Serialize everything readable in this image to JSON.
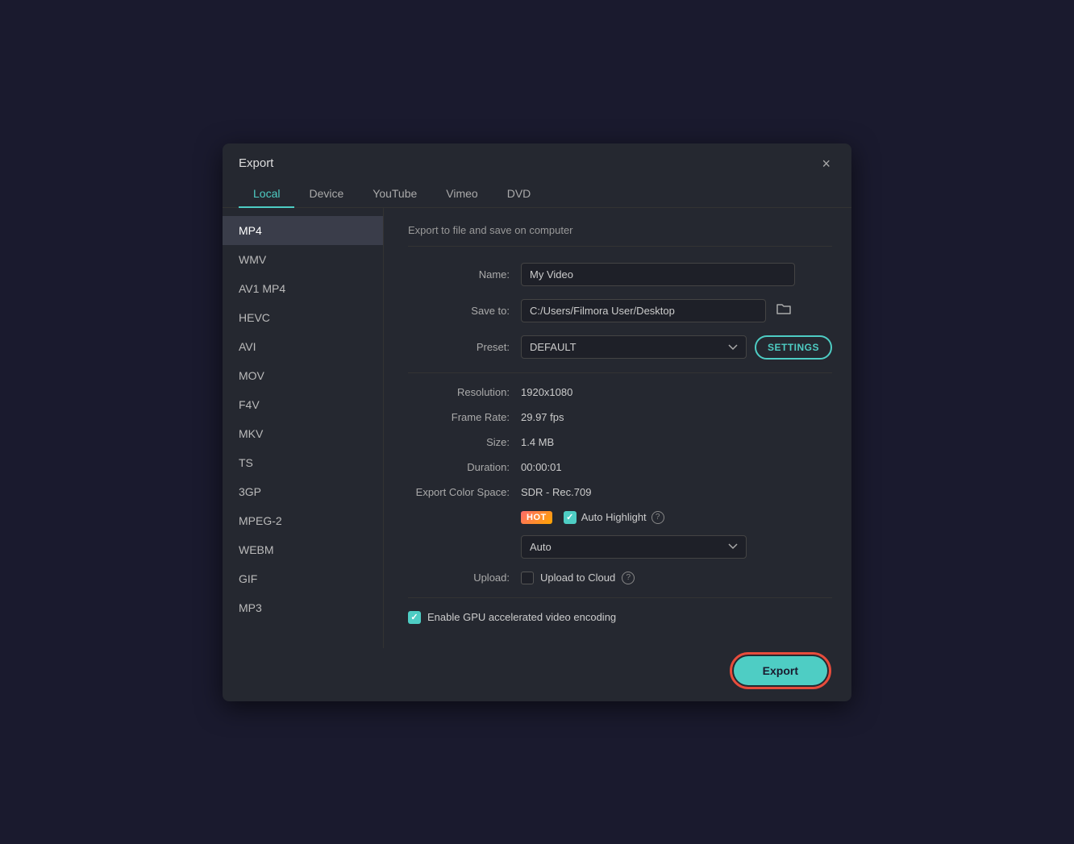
{
  "dialog": {
    "title": "Export",
    "close_label": "×"
  },
  "tabs": [
    {
      "id": "local",
      "label": "Local",
      "active": true
    },
    {
      "id": "device",
      "label": "Device",
      "active": false
    },
    {
      "id": "youtube",
      "label": "YouTube",
      "active": false
    },
    {
      "id": "vimeo",
      "label": "Vimeo",
      "active": false
    },
    {
      "id": "dvd",
      "label": "DVD",
      "active": false
    }
  ],
  "formats": [
    {
      "id": "mp4",
      "label": "MP4",
      "selected": true
    },
    {
      "id": "wmv",
      "label": "WMV",
      "selected": false
    },
    {
      "id": "av1mp4",
      "label": "AV1 MP4",
      "selected": false
    },
    {
      "id": "hevc",
      "label": "HEVC",
      "selected": false
    },
    {
      "id": "avi",
      "label": "AVI",
      "selected": false
    },
    {
      "id": "mov",
      "label": "MOV",
      "selected": false
    },
    {
      "id": "f4v",
      "label": "F4V",
      "selected": false
    },
    {
      "id": "mkv",
      "label": "MKV",
      "selected": false
    },
    {
      "id": "ts",
      "label": "TS",
      "selected": false
    },
    {
      "id": "3gp",
      "label": "3GP",
      "selected": false
    },
    {
      "id": "mpeg2",
      "label": "MPEG-2",
      "selected": false
    },
    {
      "id": "webm",
      "label": "WEBM",
      "selected": false
    },
    {
      "id": "gif",
      "label": "GIF",
      "selected": false
    },
    {
      "id": "mp3",
      "label": "MP3",
      "selected": false
    }
  ],
  "settings": {
    "description": "Export to file and save on computer",
    "name_label": "Name:",
    "name_value": "My Video",
    "saveto_label": "Save to:",
    "saveto_value": "C:/Users/Filmora User/Desktop",
    "preset_label": "Preset:",
    "preset_value": "DEFAULT",
    "settings_btn_label": "SETTINGS",
    "resolution_label": "Resolution:",
    "resolution_value": "1920x1080",
    "framerate_label": "Frame Rate:",
    "framerate_value": "29.97 fps",
    "size_label": "Size:",
    "size_value": "1.4 MB",
    "duration_label": "Duration:",
    "duration_value": "00:00:01",
    "colorspace_label": "Export Color Space:",
    "colorspace_value": "SDR - Rec.709",
    "hot_badge": "HOT",
    "auto_highlight_label": "Auto Highlight",
    "auto_highlight_checked": true,
    "auto_select_options": [
      "Auto"
    ],
    "auto_select_value": "Auto",
    "upload_label": "Upload:",
    "upload_to_cloud_label": "Upload to Cloud",
    "upload_to_cloud_checked": false,
    "gpu_label": "Enable GPU accelerated video encoding",
    "gpu_checked": true,
    "export_btn_label": "Export"
  }
}
